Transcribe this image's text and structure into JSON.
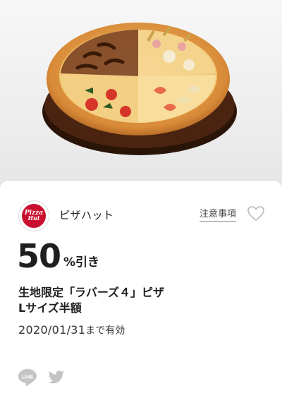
{
  "hero": {
    "image": "pizza-photo"
  },
  "coupon": {
    "logo_line1": "Pizza",
    "logo_line2": "Hut",
    "brand": "ピザハット",
    "notes_label": "注意事項",
    "favorite_icon": "heart-outline-icon",
    "discount_value": "50",
    "discount_unit": "%引き",
    "title_line1": "生地限定「ラバーズ４」ピザ",
    "title_line2": "Lサイズ半額",
    "expiry_date": "2020/01/31",
    "expiry_suffix": "まで有効"
  },
  "share": {
    "line_icon_text": "LINE",
    "twitter_icon": "twitter-bird-icon"
  },
  "colors": {
    "brand_red": "#c8102e",
    "icon_gray": "#c4c4c4"
  }
}
